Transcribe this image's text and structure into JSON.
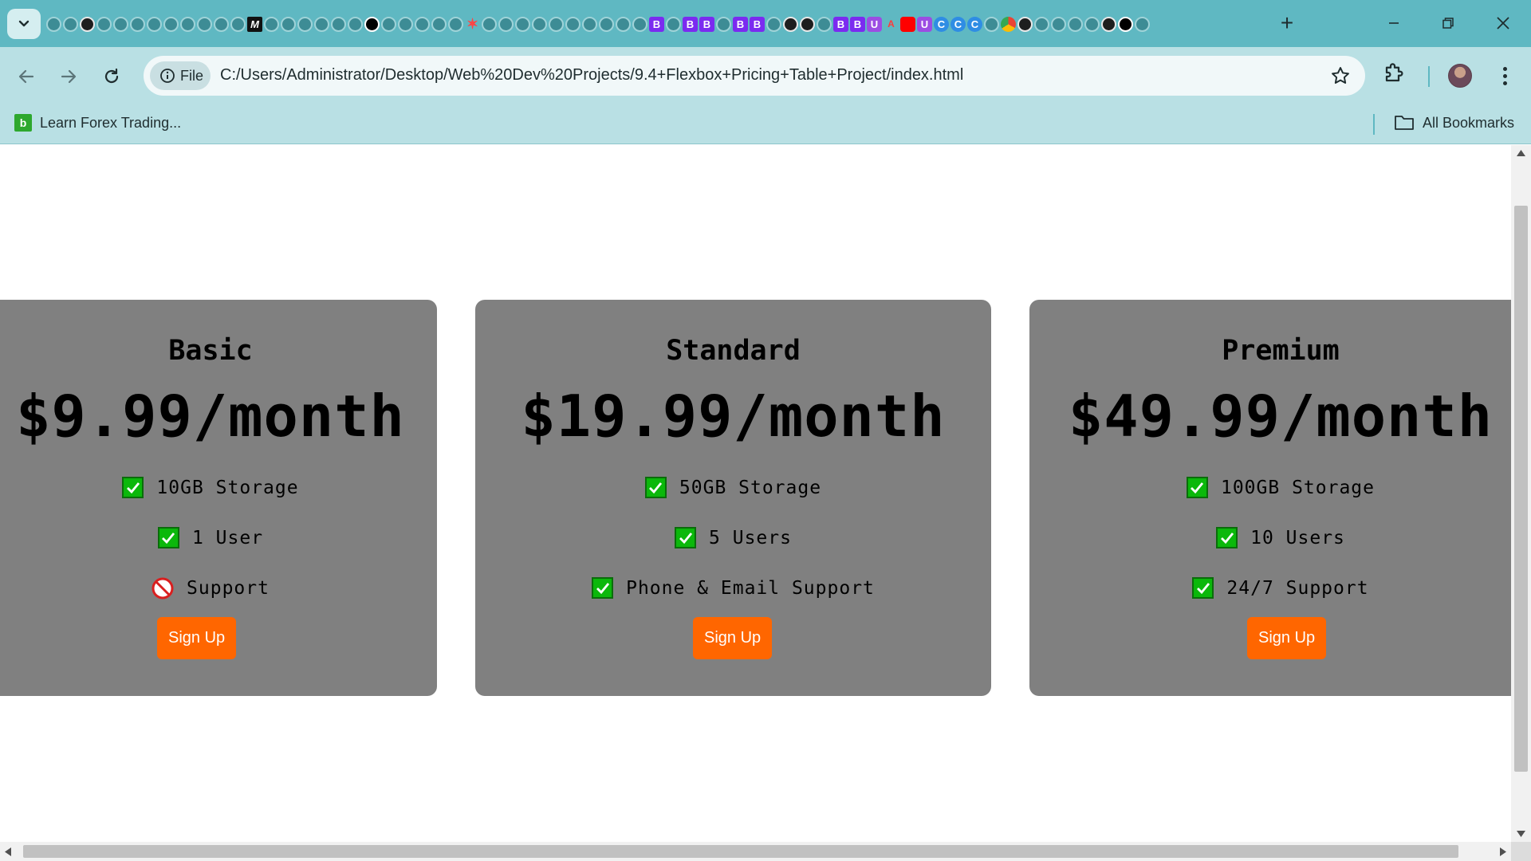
{
  "browser": {
    "address_scheme_chip": "File",
    "url": "C:/Users/Administrator/Desktop/Web%20Dev%20Projects/9.4+Flexbox+Pricing+Table+Project/index.html",
    "new_tab_symbol": "+",
    "tab_icons": [
      "globe",
      "globe",
      "gh",
      "globe",
      "globe",
      "globe",
      "globe",
      "globe",
      "globe",
      "globe",
      "globe",
      "globe",
      "m",
      "globe",
      "globe",
      "globe",
      "globe",
      "globe",
      "globe",
      "ai",
      "globe",
      "globe",
      "globe",
      "globe",
      "globe",
      "sp",
      "globe",
      "globe",
      "globe",
      "globe",
      "globe",
      "globe",
      "globe",
      "globe",
      "globe",
      "globe",
      "b",
      "globe",
      "b",
      "b",
      "globe",
      "b",
      "b",
      "globe",
      "gh",
      "gh",
      "globe",
      "b",
      "b",
      "up",
      "ms",
      "yt",
      "up",
      "c",
      "c",
      "c",
      "globe",
      "ch",
      "gh",
      "globe",
      "globe",
      "globe",
      "globe",
      "gh",
      "ai",
      "globe"
    ],
    "tab_icon_letters": {
      "m": "M",
      "b": "B",
      "c": "C",
      "sp": "✶",
      "ms": "A",
      "up": "U"
    }
  },
  "bookmarks": {
    "items": [
      {
        "label": "Learn Forex Trading...",
        "favicon_letter": "b"
      }
    ],
    "all_bookmarks_label": "All Bookmarks"
  },
  "plans": [
    {
      "name": "Basic",
      "price": "$9.99/month",
      "features": [
        {
          "text": "10GB Storage",
          "included": true
        },
        {
          "text": "1 User",
          "included": true
        },
        {
          "text": "Support",
          "included": false
        }
      ],
      "button_label": "Sign Up"
    },
    {
      "name": "Standard",
      "price": "$19.99/month",
      "features": [
        {
          "text": "50GB Storage",
          "included": true
        },
        {
          "text": "5 Users",
          "included": true
        },
        {
          "text": "Phone & Email Support",
          "included": true
        }
      ],
      "button_label": "Sign Up"
    },
    {
      "name": "Premium",
      "price": "$49.99/month",
      "features": [
        {
          "text": "100GB Storage",
          "included": true
        },
        {
          "text": "10 Users",
          "included": true
        },
        {
          "text": "24/7 Support",
          "included": true
        }
      ],
      "button_label": "Sign Up"
    }
  ],
  "colors": {
    "tab_bar": "#5fb8c2",
    "toolbar": "#b9e0e4",
    "card_background": "#808080",
    "signup_button": "#ff6600",
    "check_green": "#0bb80b"
  }
}
